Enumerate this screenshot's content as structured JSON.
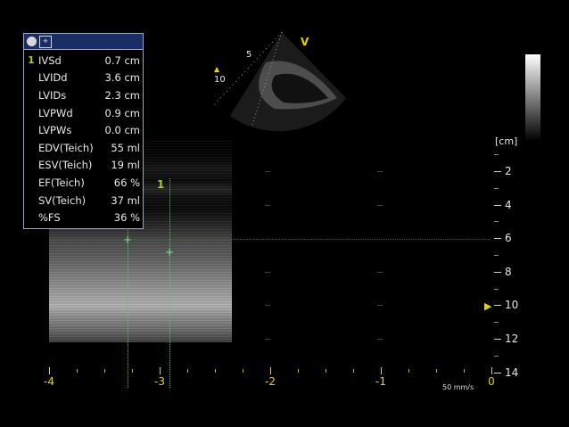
{
  "panel": {
    "rows": [
      {
        "num": "1",
        "label": "IVSd",
        "value": "0.7 cm"
      },
      {
        "num": "",
        "label": "LVIDd",
        "value": "3.6 cm"
      },
      {
        "num": "",
        "label": "LVIDs",
        "value": "2.3 cm"
      },
      {
        "num": "",
        "label": "LVPWd",
        "value": "0.9 cm"
      },
      {
        "num": "",
        "label": "LVPWs",
        "value": "0.0 cm"
      },
      {
        "num": "",
        "label": "EDV(Teich)",
        "value": "55 ml"
      },
      {
        "num": "",
        "label": "ESV(Teich)",
        "value": "19 ml"
      },
      {
        "num": "",
        "label": "EF(Teich)",
        "value": "66 %"
      },
      {
        "num": "",
        "label": "SV(Teich)",
        "value": "37 ml"
      },
      {
        "num": "",
        "label": "%FS",
        "value": "36 %"
      }
    ]
  },
  "depth_scale": {
    "unit": "[cm]",
    "labels": [
      "2",
      "4",
      "6",
      "8",
      "10",
      "12",
      "14"
    ]
  },
  "time_scale": {
    "labels": [
      "-4",
      "-3",
      "-2",
      "-1",
      "0"
    ],
    "speed": "50 mm/s"
  },
  "sector": {
    "depth_marks": [
      "5",
      "10"
    ],
    "orientation_mark": "V"
  },
  "caliper": {
    "label": "1"
  },
  "colors": {
    "accent_yellow": "#e6d300",
    "caliper_green": "#4bd14b",
    "panel_titlebar": "#1a2e66"
  }
}
